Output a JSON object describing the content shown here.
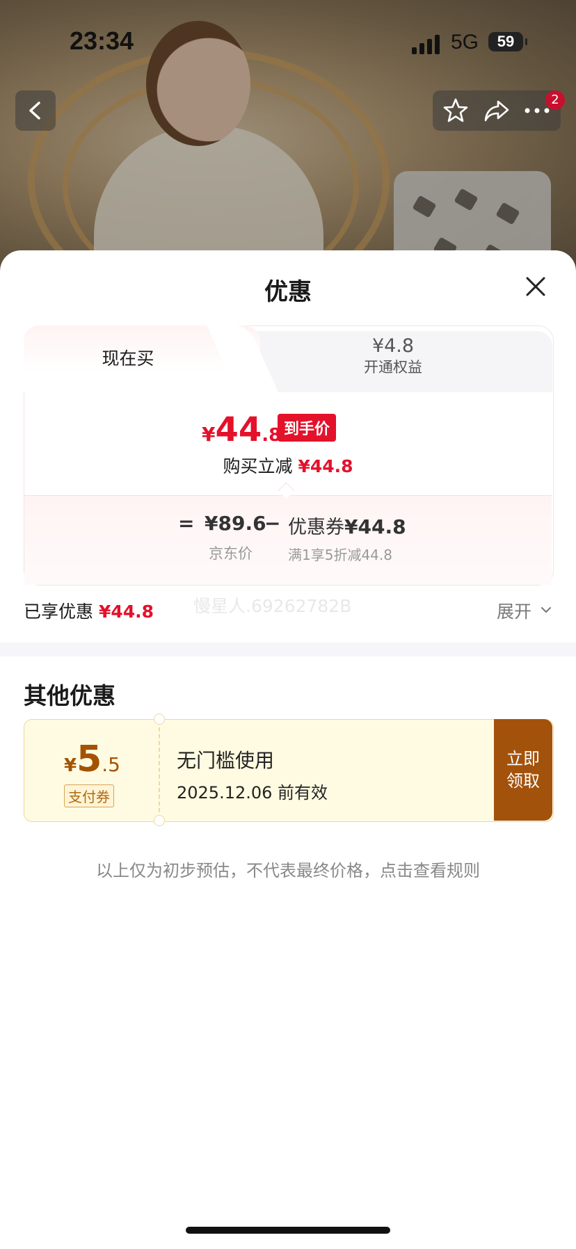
{
  "status_bar": {
    "time": "23:34",
    "network": "5G",
    "battery": "59"
  },
  "header": {
    "cart_badge": "2"
  },
  "sheet": {
    "title": "优惠",
    "tabs": {
      "now": "现在买",
      "vip_price": "¥4.8",
      "vip_label": "开通权益"
    },
    "final": {
      "currency": "¥",
      "integer": "44",
      "decimal": ".8",
      "tag": "到手价"
    },
    "reduce": {
      "label": "购买立减 ",
      "amount": "¥44.8"
    },
    "calc": {
      "equals": "=",
      "jd_price": "¥89.6",
      "minus": "−",
      "coupon_label": "优惠券",
      "coupon_amount": "¥44.8",
      "jd_price_label": "京东价",
      "coupon_rule": "满1享5折减44.8"
    },
    "enjoyed": {
      "label": "已享优惠 ",
      "amount": "¥44.8"
    },
    "watermark": "慢星人.69262782B",
    "expand_label": "展开"
  },
  "other": {
    "title": "其他优惠",
    "coupon": {
      "currency": "¥",
      "integer": "5",
      "decimal": ".5",
      "type": "支付券",
      "condition": "无门槛使用",
      "expiry": "2025.12.06 前有效",
      "button_line1": "立即",
      "button_line2": "领取"
    }
  },
  "disclaimer": "以上仅为初步预估，不代表最终价格，点击查看规则",
  "colors": {
    "accent_red": "#e4112b",
    "coupon_brown": "#a3520b",
    "coupon_bg": "#fffbe2"
  }
}
